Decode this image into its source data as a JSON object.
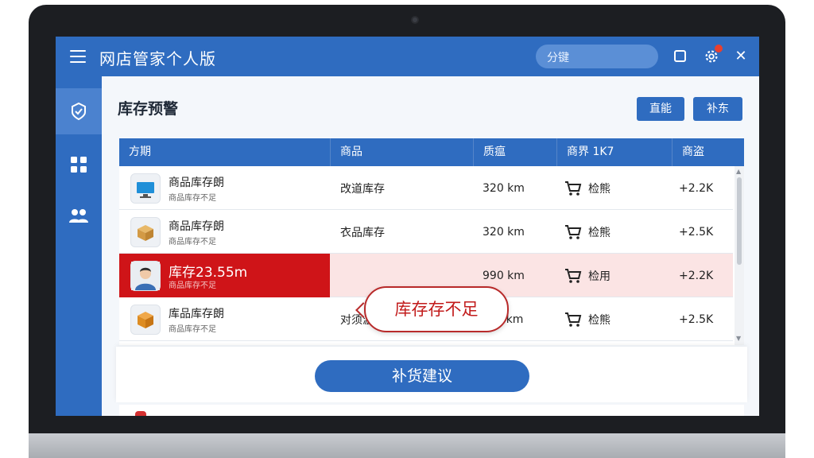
{
  "app": {
    "title": "网店管家个人版",
    "search_placeholder": "分键"
  },
  "colors": {
    "brand_blue": "#2f6cc0",
    "alert_red": "#cf1418",
    "alert_row_bg": "#fbe4e4"
  },
  "page": {
    "title": "库存预警",
    "buttons": {
      "primary": "直能",
      "secondary": "补东"
    }
  },
  "table": {
    "headers": [
      "方期",
      "商品",
      "质瘟",
      "商界 1K7",
      "商盗"
    ],
    "rows": [
      {
        "name": "商品库存朗",
        "sub": "商品库存不足",
        "icon": "monitor-icon",
        "product": "改道库存",
        "quality": "320 km",
        "action": "检熊",
        "delta": "+2.2K"
      },
      {
        "name": "商品库存朗",
        "sub": "商品库存不足",
        "icon": "box-icon",
        "product": "衣品库存",
        "quality": "320 km",
        "action": "检熊",
        "delta": "+2.5K"
      },
      {
        "name": "库存23.55m",
        "sub": "商品库存不足",
        "icon": "avatar-icon",
        "product": "",
        "quality": "990 km",
        "action": "检用",
        "delta": "+2.2K"
      },
      {
        "name": "库品库存朗",
        "sub": "商品库存不足",
        "icon": "box-icon",
        "product": "对须漩",
        "quality": "?30 km",
        "action": "检熊",
        "delta": "+2.5K"
      }
    ]
  },
  "callout": {
    "text": "库存存不足"
  },
  "suggest": {
    "label": "补货建议"
  }
}
